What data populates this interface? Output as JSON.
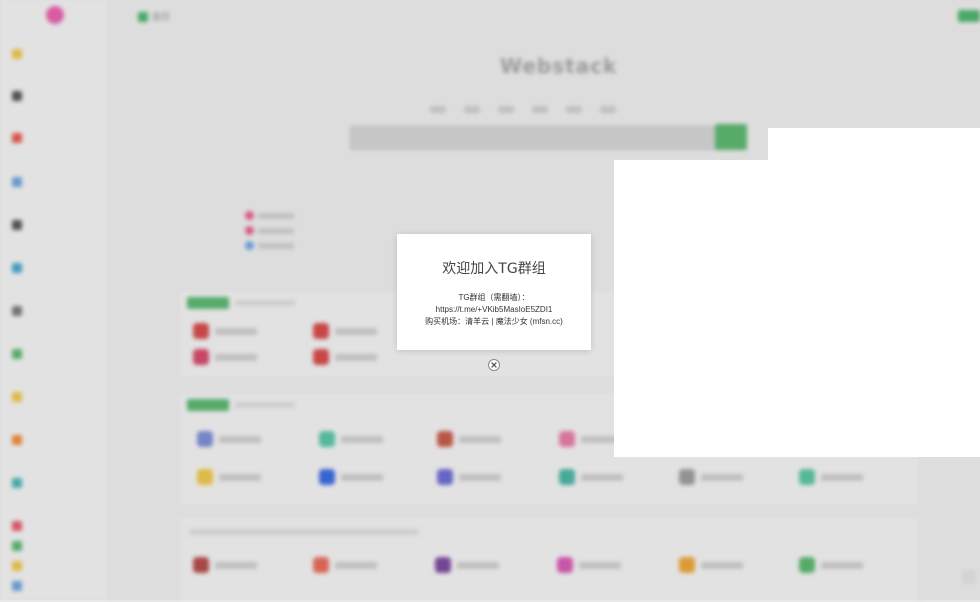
{
  "app": {
    "brand": "Webstack",
    "home_label": "首页"
  },
  "modal": {
    "title": "欢迎加入TG群组",
    "line1": "TG群组（需翻墙）：",
    "line2": "https://t.me/+VKib5MasIoE5ZDI1",
    "line3": "购买机场：清羊云 | 魔法少女 (mfsn.cc)"
  },
  "colors": {
    "accent_green": "#5ab26e",
    "modal_bg": "#ffffff",
    "page_bg": "#e7e7e7"
  },
  "icons": {
    "close": "close-circle-icon"
  }
}
